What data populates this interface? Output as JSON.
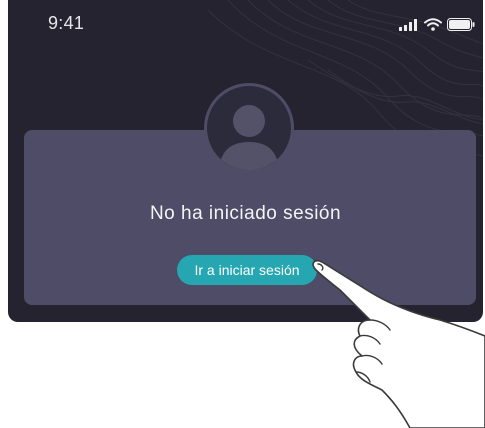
{
  "status_bar": {
    "time": "9:41",
    "icons": [
      "signal-icon",
      "wifi-icon",
      "battery-icon"
    ]
  },
  "main": {
    "message": "No ha iniciado sesión",
    "login_button_label": "Ir a iniciar sesión"
  },
  "colors": {
    "background": "#25232f",
    "card": "#4e4c66",
    "accent": "#26a6b0",
    "text": "#f4f4f7"
  }
}
